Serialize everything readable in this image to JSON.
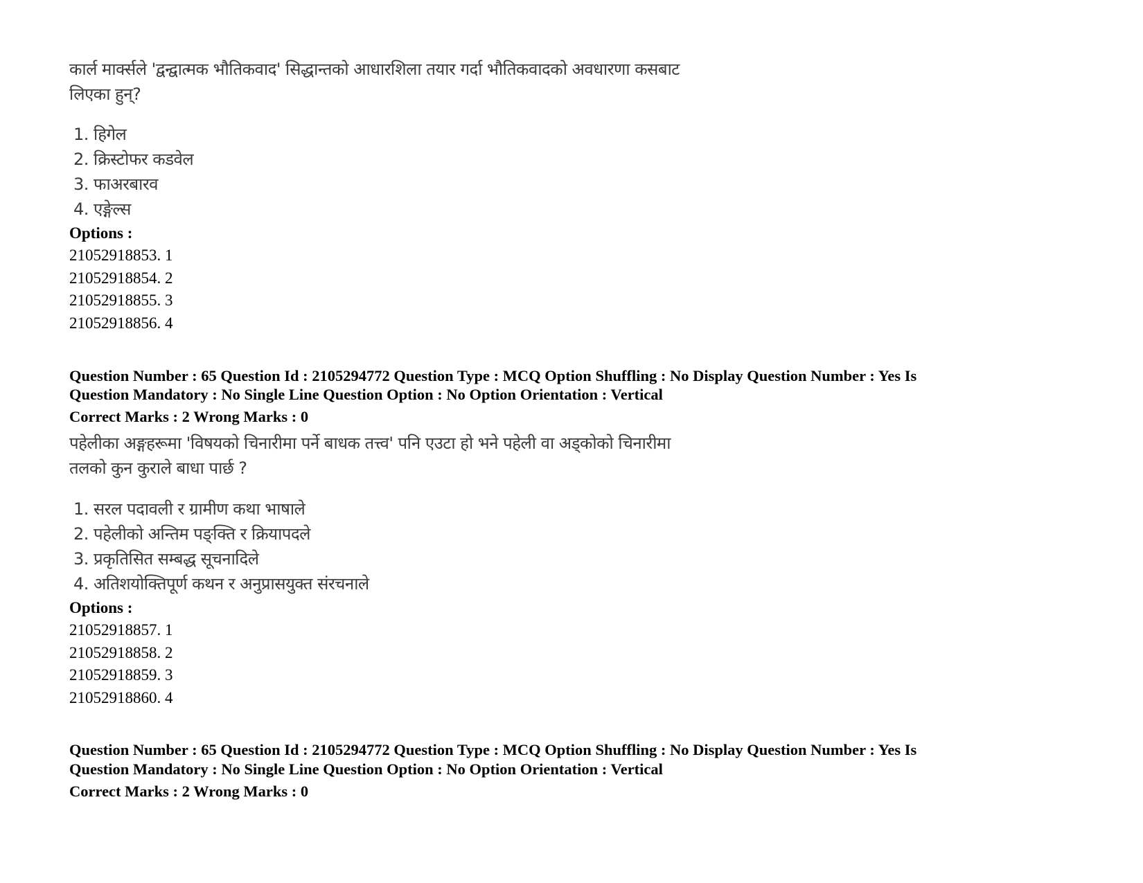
{
  "block1": {
    "question_line1": "कार्ल मार्क्सले 'द्वन्द्वात्मक भौतिकवाद' सिद्धान्तको आधारशिला तयार गर्दा भौतिकवादको अवधारणा कसबाट",
    "question_line2": "लिएका हुन्?",
    "choices": [
      "1. हिगेल",
      "2. क्रिस्टोफर कडवेल",
      "3. फाअरबारव",
      "4. एङ्गेल्स"
    ],
    "options_label": "Options :",
    "options": [
      "21052918853. 1",
      "21052918854. 2",
      "21052918855. 3",
      "21052918856. 4"
    ]
  },
  "block2": {
    "meta_line1": "Question Number : 65 Question Id : 2105294772 Question Type : MCQ Option Shuffling : No Display Question Number : Yes Is",
    "meta_line2": "Question Mandatory : No Single Line Question Option : No Option Orientation : Vertical",
    "marks": "Correct Marks : 2 Wrong Marks : 0",
    "question_line1": "पहेलीका अङ्गहरूमा 'विषयको चिनारीमा पर्ने बाधक तत्त्व' पनि एउटा हो भने पहेली वा अड्कोको चिनारीमा",
    "question_line2": "तलको कुन कुराले बाधा पार्छ ?",
    "choices": [
      "1. सरल पदावली र ग्रामीण कथा भाषाले",
      "2. पहेलीको अन्तिम पङ्क्ति र क्रियापदले",
      "3. प्रकृतिसित सम्बद्ध सूचनादिले",
      "4. अतिशयोक्तिपूर्ण कथन र अनुप्रासयुक्त संरचनाले"
    ],
    "options_label": "Options :",
    "options": [
      "21052918857. 1",
      "21052918858. 2",
      "21052918859. 3",
      "21052918860. 4"
    ]
  },
  "block3": {
    "meta_line1": "Question Number : 65 Question Id : 2105294772 Question Type : MCQ Option Shuffling : No Display Question Number : Yes Is",
    "meta_line2": "Question Mandatory : No Single Line Question Option : No Option Orientation : Vertical",
    "marks": "Correct Marks : 2 Wrong Marks : 0"
  }
}
